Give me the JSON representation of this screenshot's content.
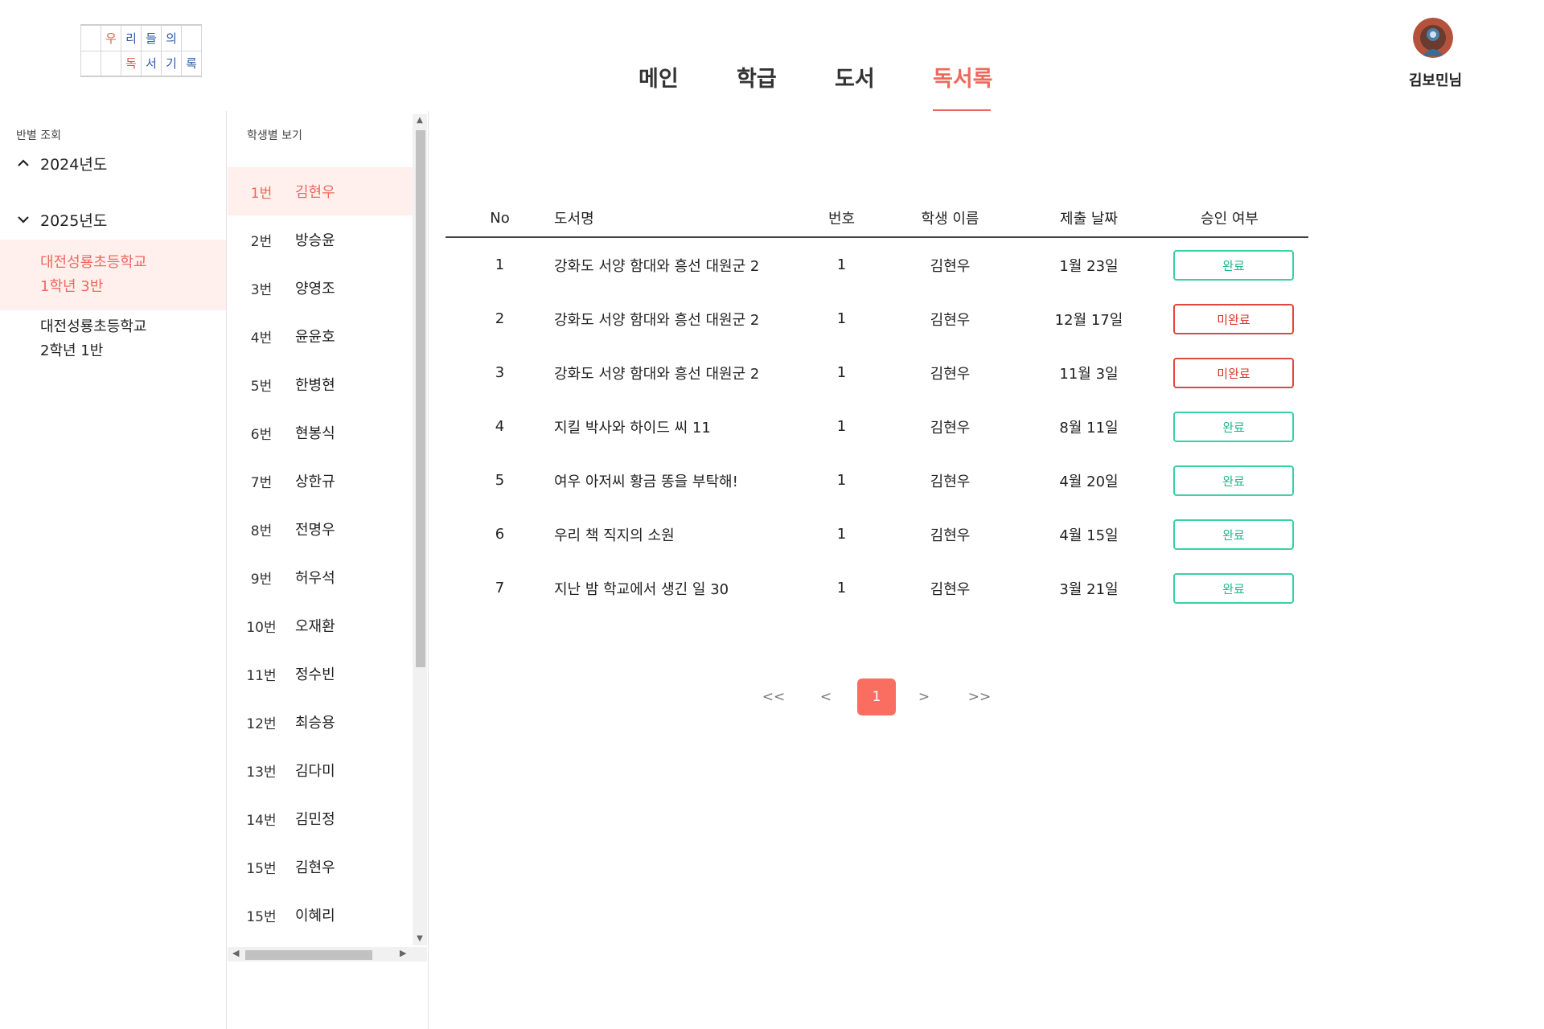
{
  "logo": {
    "row1": [
      "",
      "우",
      "리",
      "들",
      "의",
      ""
    ],
    "row2": [
      "",
      "",
      "독",
      "서",
      "기",
      "록"
    ]
  },
  "nav": {
    "items": [
      {
        "label": "메인"
      },
      {
        "label": "학급"
      },
      {
        "label": "도서"
      },
      {
        "label": "독서록",
        "active": true
      }
    ]
  },
  "profile": {
    "name": "김보민님"
  },
  "sidebar": {
    "title": "반별 조회",
    "years": [
      {
        "label": "2024년도",
        "chevron": "chevron-up-icon"
      },
      {
        "label": "2025년도",
        "chevron": "chevron-down-icon"
      }
    ],
    "classes": [
      {
        "school": "대전성룡초등학교",
        "class": "1학년 3반",
        "active": true
      },
      {
        "school": "대전성룡초등학교",
        "class": "2학년 1반",
        "active": false
      }
    ]
  },
  "students": {
    "title": "학생별 보기",
    "items": [
      {
        "num": "1번",
        "name": "김현우",
        "active": true
      },
      {
        "num": "2번",
        "name": "방승윤"
      },
      {
        "num": "3번",
        "name": "양영조"
      },
      {
        "num": "4번",
        "name": "윤윤호"
      },
      {
        "num": "5번",
        "name": "한병현"
      },
      {
        "num": "6번",
        "name": "현봉식"
      },
      {
        "num": "7번",
        "name": "상한규"
      },
      {
        "num": "8번",
        "name": "전명우"
      },
      {
        "num": "9번",
        "name": "허우석"
      },
      {
        "num": "10번",
        "name": "오재환"
      },
      {
        "num": "11번",
        "name": "정수빈"
      },
      {
        "num": "12번",
        "name": "최승용"
      },
      {
        "num": "13번",
        "name": "김다미"
      },
      {
        "num": "14번",
        "name": "김민정"
      },
      {
        "num": "15번",
        "name": "김현우"
      },
      {
        "num": "15번",
        "name": "이혜리"
      }
    ]
  },
  "table": {
    "headers": {
      "no": "No",
      "title": "도서명",
      "num": "번호",
      "name": "학생 이름",
      "date": "제출 날짜",
      "status": "승인 여부"
    },
    "rows": [
      {
        "no": "1",
        "title": "강화도 서양 함대와 흥선 대원군 2",
        "num": "1",
        "name": "김현우",
        "date": "1월 23일",
        "status": "완료",
        "state": "done"
      },
      {
        "no": "2",
        "title": "강화도 서양 함대와 흥선 대원군 2",
        "num": "1",
        "name": "김현우",
        "date": "12월 17일",
        "status": "미완료",
        "state": "pending"
      },
      {
        "no": "3",
        "title": "강화도 서양 함대와 흥선 대원군 2",
        "num": "1",
        "name": "김현우",
        "date": "11월 3일",
        "status": "미완료",
        "state": "pending"
      },
      {
        "no": "4",
        "title": "지킬 박사와 하이드 씨 11",
        "num": "1",
        "name": "김현우",
        "date": "8월 11일",
        "status": "완료",
        "state": "done"
      },
      {
        "no": "5",
        "title": "여우 아저씨 황금 똥을 부탁해!",
        "num": "1",
        "name": "김현우",
        "date": "4월 20일",
        "status": "완료",
        "state": "done"
      },
      {
        "no": "6",
        "title": "우리 책 직지의 소원",
        "num": "1",
        "name": "김현우",
        "date": "4월 15일",
        "status": "완료",
        "state": "done"
      },
      {
        "no": "7",
        "title": "지난 밤 학교에서 생긴 일 30",
        "num": "1",
        "name": "김현우",
        "date": "3월 21일",
        "status": "완료",
        "state": "done"
      }
    ]
  },
  "pagination": {
    "first": "<<",
    "prev": "<",
    "current": "1",
    "next": ">",
    "last": ">>"
  },
  "colors": {
    "accent": "#f0685c",
    "done": "#3ad0a6",
    "pending": "#e0483d",
    "active_bg": "#fff0ee"
  }
}
